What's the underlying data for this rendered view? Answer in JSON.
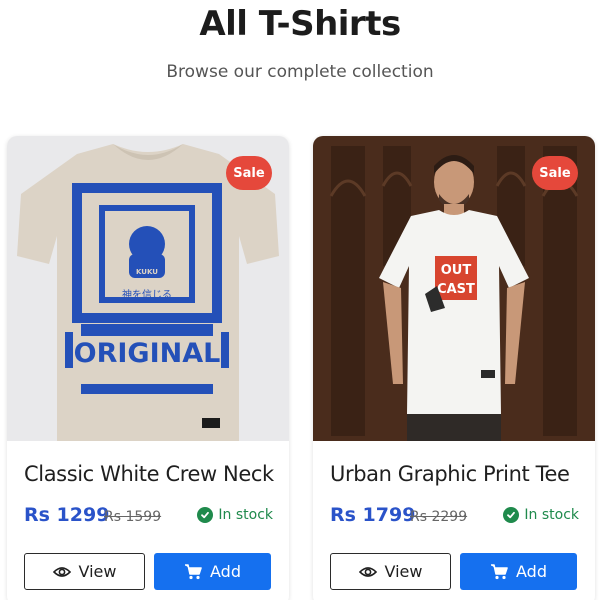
{
  "header": {
    "title": "All T-Shirts",
    "subtitle": "Browse our complete collection"
  },
  "products": [
    {
      "name": "Classic White Crew Neck",
      "price": "Rs 1299",
      "old_price": "Rs 1599",
      "badge": "Sale",
      "stock": "In stock",
      "view_label": "View",
      "add_label": "Add",
      "print_text": "ORIGINAL",
      "print_small": "KUKU",
      "print_jp": "神を信じる"
    },
    {
      "name": "Urban Graphic Print Tee",
      "price": "Rs 1799",
      "old_price": "Rs 2299",
      "badge": "Sale",
      "stock": "In stock",
      "view_label": "View",
      "add_label": "Add",
      "print_text_1": "OUT",
      "print_text_2": "CAST"
    }
  ],
  "colors": {
    "accent": "#1570ef",
    "price": "#2a53c9",
    "sale": "#e5483b",
    "in_stock": "#1f8a4c"
  },
  "icons": {
    "view": "eye-icon",
    "add": "cart-icon",
    "stock": "check-circle-icon"
  }
}
